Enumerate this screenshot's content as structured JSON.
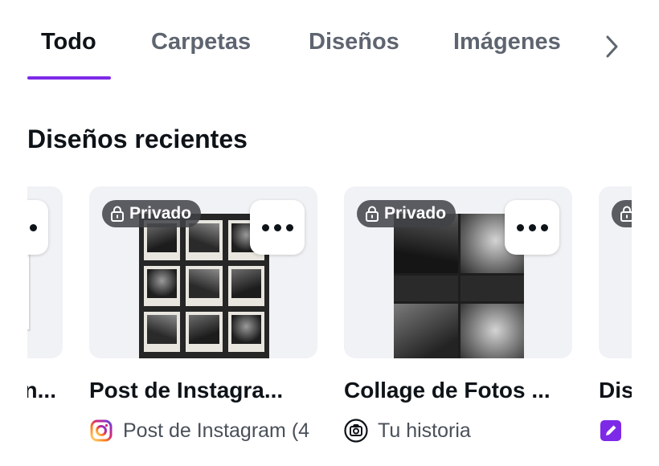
{
  "tabs": {
    "items": [
      {
        "label": "Todo",
        "active": true
      },
      {
        "label": "Carpetas",
        "active": false
      },
      {
        "label": "Diseños",
        "active": false
      },
      {
        "label": "Imágenes",
        "active": false
      }
    ],
    "accent_color": "#7d2ae8",
    "next_icon": "chevron-right-icon"
  },
  "section": {
    "title": "Diseños recientes"
  },
  "cards": {
    "partial_left": {
      "title_fragment": "n..."
    },
    "items": [
      {
        "badge": "Privado",
        "badge_icon": "lock-icon",
        "title": "Post de Instagra...",
        "type_label": "Post de Instagram (4",
        "type_icon": "instagram-icon"
      },
      {
        "badge": "Privado",
        "badge_icon": "lock-icon",
        "title": "Collage de Fotos ...",
        "type_label": "Tu historia",
        "type_icon": "camera-icon"
      }
    ],
    "partial_right": {
      "title_fragment": "Dis",
      "type_icon": "edit-icon",
      "type_icon_color": "#7d2ae8"
    }
  }
}
